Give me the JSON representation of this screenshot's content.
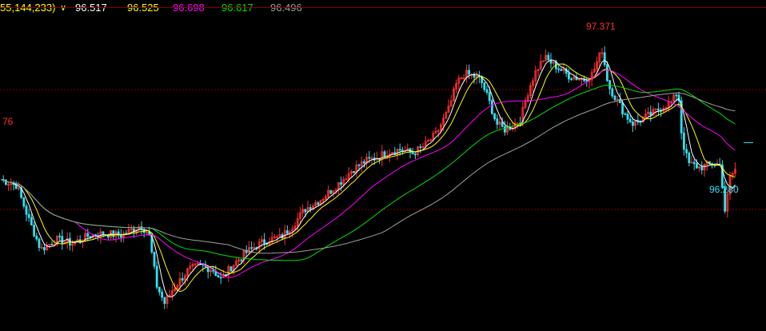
{
  "header": {
    "params_text": "55,144,233)",
    "menu_label": "∨",
    "ma_values": [
      "96.517",
      "96.525",
      "96.698",
      "96.617",
      "96.496"
    ]
  },
  "colors": {
    "background": "#000000",
    "bull": "#ff3030",
    "bear": "#30e0f0",
    "ma1": "#ffffff",
    "ma2": "#ffff00",
    "ma3": "#ff00ff",
    "ma4": "#00e000",
    "ma5": "#a0a0a0",
    "grid": "#800000"
  },
  "chart_data": {
    "type": "candlestick",
    "high_label": "97.371",
    "low_label": "96.280",
    "left_edge_label": "76",
    "price_anchors": [
      [
        0,
        96.65
      ],
      [
        20,
        96.62
      ],
      [
        35,
        96.45
      ],
      [
        50,
        96.3
      ],
      [
        70,
        96.35
      ],
      [
        90,
        96.33
      ],
      [
        110,
        96.37
      ],
      [
        130,
        96.38
      ],
      [
        150,
        96.37
      ],
      [
        165,
        96.4
      ],
      [
        175,
        96.42
      ],
      [
        185,
        96.38
      ],
      [
        195,
        96.12
      ],
      [
        205,
        96.03
      ],
      [
        215,
        96.1
      ],
      [
        225,
        96.15
      ],
      [
        235,
        96.2
      ],
      [
        250,
        96.22
      ],
      [
        265,
        96.2
      ],
      [
        275,
        96.15
      ],
      [
        290,
        96.22
      ],
      [
        305,
        96.28
      ],
      [
        320,
        96.32
      ],
      [
        335,
        96.35
      ],
      [
        350,
        96.36
      ],
      [
        365,
        96.42
      ],
      [
        380,
        96.5
      ],
      [
        400,
        96.55
      ],
      [
        420,
        96.62
      ],
      [
        440,
        96.7
      ],
      [
        455,
        96.74
      ],
      [
        470,
        96.76
      ],
      [
        485,
        96.79
      ],
      [
        500,
        96.8
      ],
      [
        515,
        96.78
      ],
      [
        530,
        96.82
      ],
      [
        545,
        96.88
      ],
      [
        560,
        97.0
      ],
      [
        570,
        97.13
      ],
      [
        580,
        97.18
      ],
      [
        590,
        97.17
      ],
      [
        600,
        97.15
      ],
      [
        610,
        97.05
      ],
      [
        620,
        96.93
      ],
      [
        630,
        96.9
      ],
      [
        640,
        96.92
      ],
      [
        650,
        96.95
      ],
      [
        660,
        97.1
      ],
      [
        670,
        97.2
      ],
      [
        680,
        97.26
      ],
      [
        690,
        97.23
      ],
      [
        700,
        97.2
      ],
      [
        710,
        97.17
      ],
      [
        720,
        97.16
      ],
      [
        730,
        97.15
      ],
      [
        740,
        97.18
      ],
      [
        752,
        97.3
      ],
      [
        760,
        97.12
      ],
      [
        770,
        97.05
      ],
      [
        780,
        96.98
      ],
      [
        790,
        96.93
      ],
      [
        800,
        96.95
      ],
      [
        815,
        96.98
      ],
      [
        830,
        97.02
      ],
      [
        840,
        97.04
      ],
      [
        847,
        97.1
      ],
      [
        852,
        96.85
      ],
      [
        860,
        96.73
      ],
      [
        875,
        96.71
      ],
      [
        890,
        96.73
      ],
      [
        900,
        96.72
      ],
      [
        906,
        96.48
      ],
      [
        912,
        96.66
      ],
      [
        920,
        96.71
      ]
    ],
    "grid_levels": [
      97.1,
      96.5
    ],
    "x_range": [
      0,
      920
    ],
    "y_range": [
      95.9,
      97.5
    ]
  }
}
